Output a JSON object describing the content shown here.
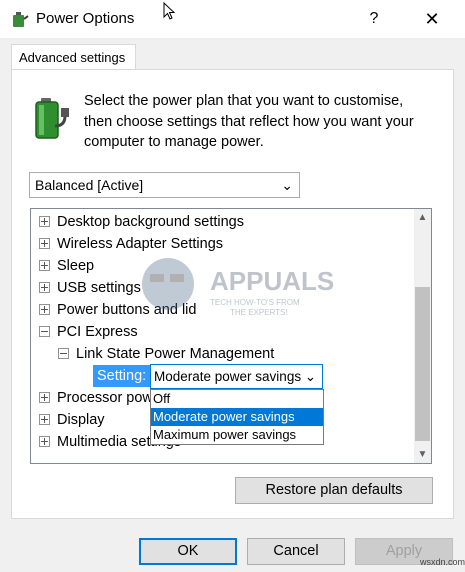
{
  "window": {
    "title": "Power Options",
    "help_label": "?",
    "close_label": "✕"
  },
  "tab": {
    "label": "Advanced settings"
  },
  "description": "Select the power plan that you want to customise, then choose settings that reflect how you want your computer to manage power.",
  "plan_select": {
    "value": "Balanced [Active]"
  },
  "tree": {
    "items": [
      {
        "label": "Desktop background settings",
        "state": "collapsed"
      },
      {
        "label": "Wireless Adapter Settings",
        "state": "collapsed"
      },
      {
        "label": "Sleep",
        "state": "collapsed"
      },
      {
        "label": "USB settings",
        "state": "collapsed"
      },
      {
        "label": "Power buttons and lid",
        "state": "collapsed"
      },
      {
        "label": "PCI Express",
        "state": "expanded"
      },
      {
        "label": "Link State Power Management",
        "state": "expanded"
      },
      {
        "label": "Processor power management",
        "state": "collapsed"
      },
      {
        "label": "Display",
        "state": "collapsed"
      },
      {
        "label": "Multimedia settings",
        "state": "collapsed"
      }
    ],
    "setting_label": "Setting:",
    "setting_value": "Moderate power savings",
    "options": [
      "Off",
      "Moderate power savings",
      "Maximum power savings"
    ],
    "selected_option": "Moderate power savings"
  },
  "buttons": {
    "restore": "Restore plan defaults",
    "ok": "OK",
    "cancel": "Cancel",
    "apply": "Apply"
  },
  "watermark": {
    "brand": "APPUALS",
    "tagline_1": "TECH HOW-TO'S FROM",
    "tagline_2": "THE EXPERTS!"
  },
  "corner_watermark": "wsxdn.com",
  "colors": {
    "accent": "#0078d7",
    "selection_highlight": "#3399ff",
    "window_bg": "#f0f0f0"
  }
}
